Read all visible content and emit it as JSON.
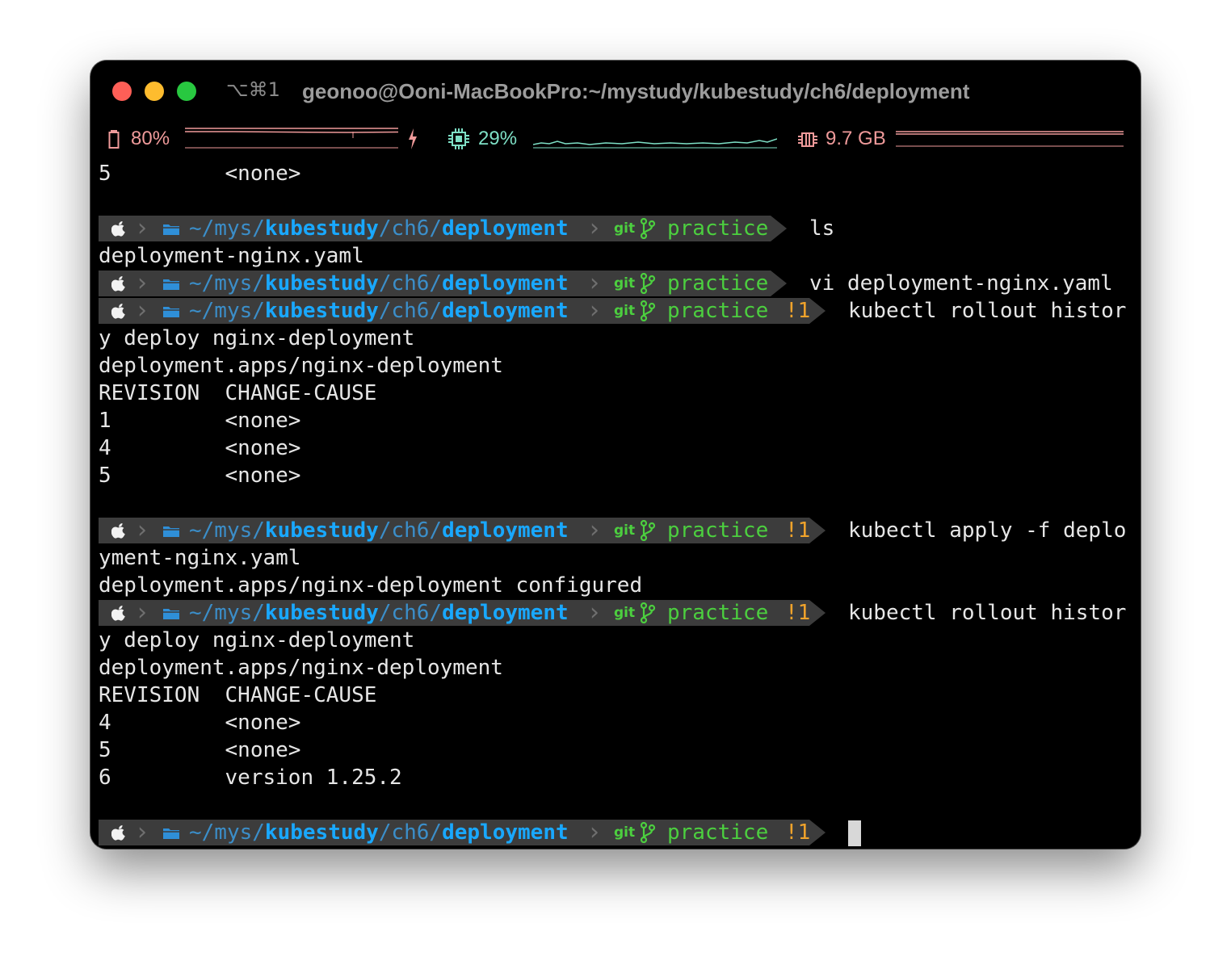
{
  "window": {
    "shortcut": "⌥⌘1",
    "title": "geonoo@Ooni-MacBookPro:~/mystudy/kubestudy/ch6/deployment"
  },
  "status": {
    "battery": "80%",
    "cpu": "29%",
    "memory": "9.7 GB"
  },
  "prompt": {
    "path_prefix": "~/mys/",
    "path_bold1": "kubestudy",
    "path_mid": "/ch6/",
    "path_bold2": "deployment",
    "git_label": "git",
    "branch": "practice",
    "dirty": "!1"
  },
  "lines": {
    "l0": "5         <none>",
    "p1_cmd": "ls",
    "o1": "deployment-nginx.yaml",
    "p2_cmd": "vi deployment-nginx.yaml",
    "p3_cmd": "kubectl rollout histor",
    "o3a": "y deploy nginx-deployment",
    "o3b": "deployment.apps/nginx-deployment",
    "o3c": "REVISION  CHANGE-CAUSE",
    "o3d": "1         <none>",
    "o3e": "4         <none>",
    "o3f": "5         <none>",
    "p4_cmd": "kubectl apply -f deplo",
    "o4a": "yment-nginx.yaml",
    "o4b": "deployment.apps/nginx-deployment configured",
    "p5_cmd": "kubectl rollout histor",
    "o5a": "y deploy nginx-deployment",
    "o5b": "deployment.apps/nginx-deployment",
    "o5c": "REVISION  CHANGE-CAUSE",
    "o5d": "4         <none>",
    "o5e": "5         <none>",
    "o5f": "6         version 1.25.2"
  },
  "colors": {
    "path_dim": "#3b8ec9",
    "path_bright": "#19a8ff",
    "git_green": "#4ccf3f",
    "dirty_orange": "#f0a32b",
    "segment_bg": "#3c3c3c",
    "status_pink": "#ef9a9a",
    "status_teal": "#7ee0c6"
  }
}
